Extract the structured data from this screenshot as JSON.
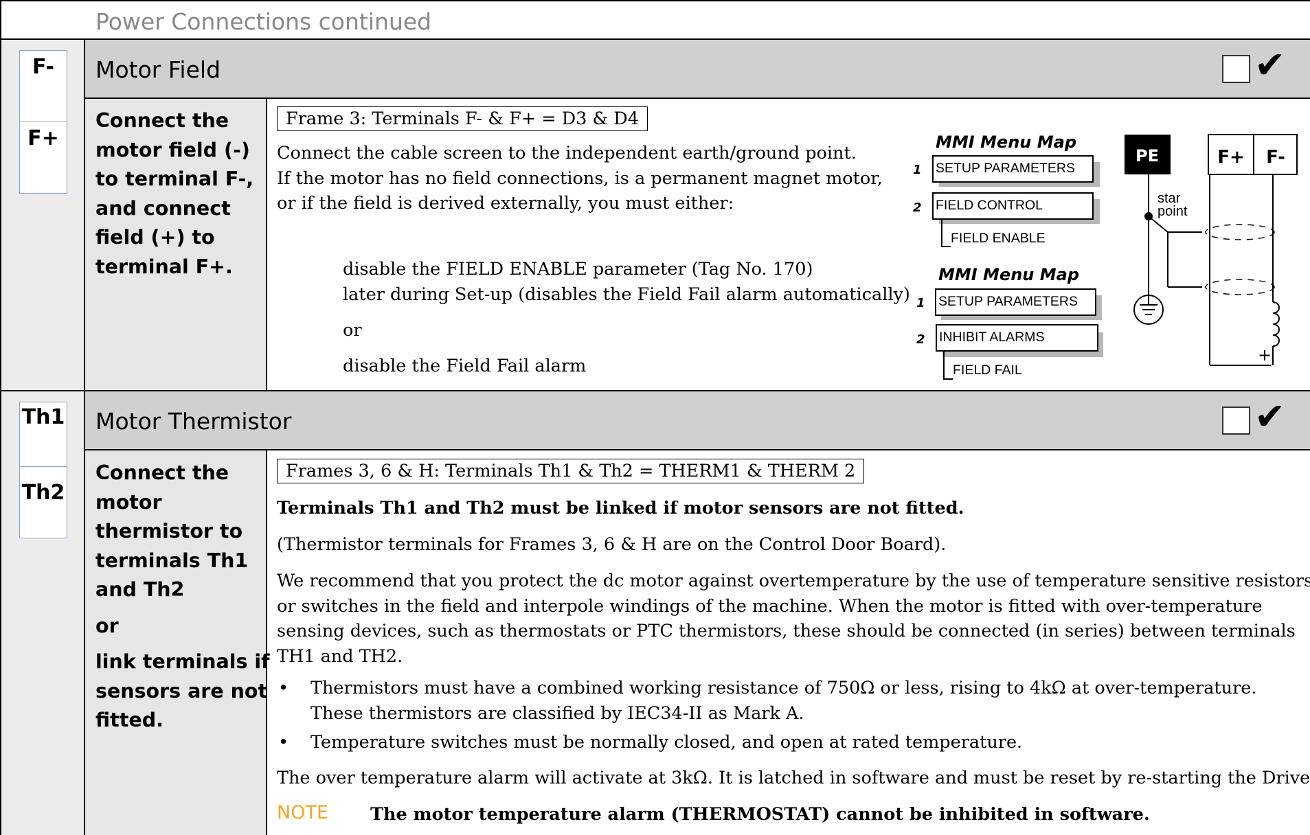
{
  "page_header": "Power Connections continued",
  "check_mark": "✔",
  "sections": {
    "motor_field": {
      "terminals": [
        "F-",
        "F+"
      ],
      "title": "Motor Field",
      "left_text": [
        "Connect the",
        "motor field (-)",
        "to terminal F-,",
        "and connect",
        "field (+) to",
        "terminal F+."
      ],
      "frame_note": "Frame 3: Terminals F- & F+ = D3 & D4",
      "paragraph": [
        "Connect the cable screen to the independent earth/ground point.",
        "If the motor has no field connections, is a permanent magnet motor,",
        "or if the field is derived externally, you must either:"
      ],
      "option1": [
        "disable the FIELD ENABLE parameter (Tag No. 170)",
        "later during Set-up (disables the Field Fail alarm automatically)"
      ],
      "or": "or",
      "option2": "disable the Field Fail alarm",
      "mmi_maps": [
        {
          "title": "MMI Menu Map",
          "items": [
            {
              "num": "1",
              "label": "SETUP PARAMETERS"
            },
            {
              "num": "2",
              "label": "FIELD CONTROL"
            }
          ],
          "leaf": "FIELD ENABLE"
        },
        {
          "title": "MMI Menu Map",
          "items": [
            {
              "num": "1",
              "label": "SETUP PARAMETERS"
            },
            {
              "num": "2",
              "label": "INHIBIT ALARMS"
            }
          ],
          "leaf": "FIELD FAIL"
        }
      ],
      "diagram": {
        "pe": "PE",
        "f_plus": "F+",
        "f_minus": "F-",
        "star": "star",
        "point": "point",
        "plus": "+"
      }
    },
    "motor_thermistor": {
      "terminals": [
        "Th1",
        "Th2"
      ],
      "title": "Motor Thermistor",
      "left_text": [
        "Connect the",
        "motor",
        "thermistor to",
        "terminals Th1",
        "and Th2",
        "or",
        "link terminals if",
        "sensors are not",
        "fitted."
      ],
      "frame_note": "Frames 3, 6 & H: Terminals Th1 & Th2 = THERM1 & THERM 2",
      "bold_line": "Terminals Th1 and Th2 must be linked if motor sensors are not fitted.",
      "paren_line": "(Thermistor terminals for Frames 3, 6 & H are on the Control Door Board).",
      "recommend": [
        "We recommend that you protect the dc motor against overtemperature by the use of temperature sensitive resistors",
        "or switches in the field and interpole windings of the machine. When the motor is fitted with over-temperature",
        "sensing devices, such as thermostats or PTC thermistors, these should be connected (in series) between terminals",
        "TH1 and TH2."
      ],
      "bullets": [
        [
          "Thermistors must have a combined working resistance of 750Ω  or less, rising to 4kΩ at over-temperature.",
          "These thermistors are classified by IEC34-II as Mark A."
        ],
        [
          "Temperature switches must be normally closed, and open at rated temperature."
        ]
      ],
      "alarm_line": "The over temperature alarm will activate at 3kΩ. It is latched in software and must be reset by re-starting the Drive.",
      "note_label": "NOTE",
      "note_text": "The motor temperature alarm (THERMOSTAT) cannot be inhibited in software.",
      "colors": {
        "note": "#f5a623",
        "section_header": "#d0d0d0",
        "left_column": "#e6e6e6",
        "terminal_strip": "#ececec"
      }
    }
  }
}
